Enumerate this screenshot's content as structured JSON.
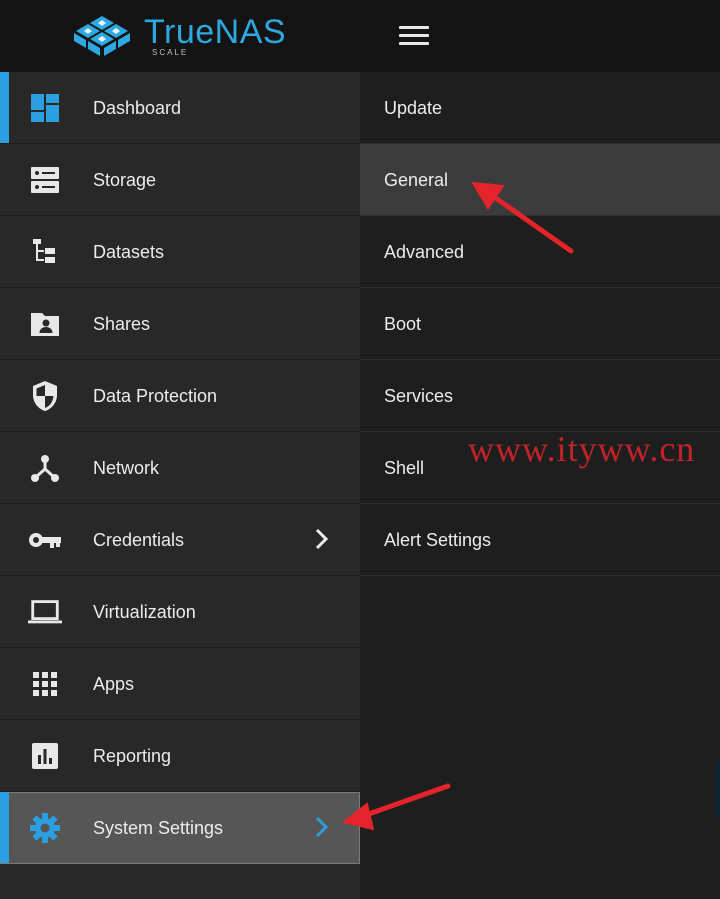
{
  "brand": {
    "name": "TrueNAS",
    "edition": "SCALE",
    "accent": "#2ea8e0"
  },
  "sidebar": {
    "items": [
      {
        "label": "Dashboard",
        "icon": "dashboard-icon"
      },
      {
        "label": "Storage",
        "icon": "storage-icon"
      },
      {
        "label": "Datasets",
        "icon": "datasets-icon"
      },
      {
        "label": "Shares",
        "icon": "shares-icon"
      },
      {
        "label": "Data Protection",
        "icon": "shield-icon"
      },
      {
        "label": "Network",
        "icon": "network-icon"
      },
      {
        "label": "Credentials",
        "icon": "key-icon"
      },
      {
        "label": "Virtualization",
        "icon": "laptop-icon"
      },
      {
        "label": "Apps",
        "icon": "apps-grid-icon"
      },
      {
        "label": "Reporting",
        "icon": "reporting-icon"
      },
      {
        "label": "System Settings",
        "icon": "gear-icon"
      }
    ]
  },
  "submenu": {
    "items": [
      {
        "label": "Update"
      },
      {
        "label": "General"
      },
      {
        "label": "Advanced"
      },
      {
        "label": "Boot"
      },
      {
        "label": "Services"
      },
      {
        "label": "Shell"
      },
      {
        "label": "Alert Settings"
      }
    ]
  },
  "watermark": "www.ityww.cn",
  "colors": {
    "active_accent": "#2b9fe0",
    "arrow": "#e3242b",
    "sidebar_bg": "#282828",
    "submenu_bg": "#1e1e1e"
  }
}
